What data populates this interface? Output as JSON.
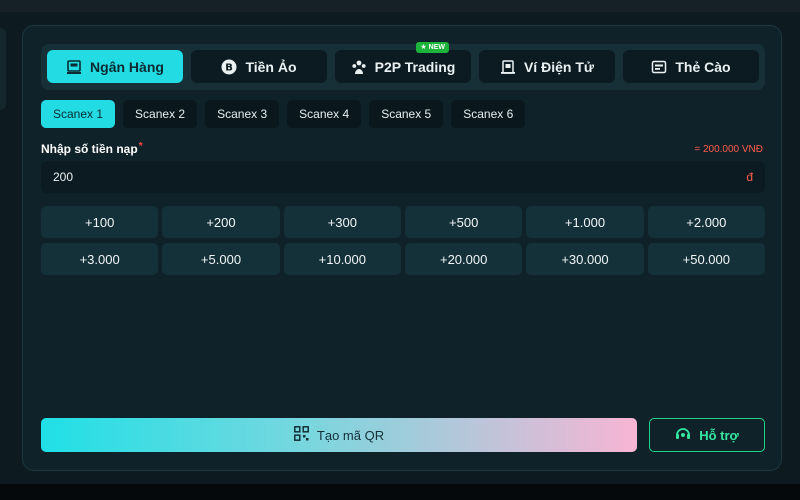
{
  "tabs": [
    {
      "label": "Ngân Hàng",
      "icon": "bank-card-icon",
      "active": true
    },
    {
      "label": "Tiền Ảo",
      "icon": "bitcoin-icon",
      "active": false
    },
    {
      "label": "P2P Trading",
      "icon": "users-icon",
      "active": false,
      "badge": "NEW"
    },
    {
      "label": "Ví Điện Tử",
      "icon": "wallet-icon",
      "active": false
    },
    {
      "label": "Thẻ Cào",
      "icon": "scratch-card-icon",
      "active": false
    }
  ],
  "subtabs": [
    "Scanex 1",
    "Scanex 2",
    "Scanex 3",
    "Scanex 4",
    "Scanex 5",
    "Scanex 6"
  ],
  "amount": {
    "label": "Nhập số tiền nạp",
    "required_mark": "*",
    "conversion": "= 200.000 VNĐ",
    "value": "200",
    "currency": "đ"
  },
  "quick_amounts": [
    "+100",
    "+200",
    "+300",
    "+500",
    "+1.000",
    "+2.000",
    "+3.000",
    "+5.000",
    "+10.000",
    "+20.000",
    "+30.000",
    "+50.000"
  ],
  "actions": {
    "create_qr": "Tạo mã QR",
    "support": "Hỗ trợ"
  },
  "colors": {
    "accent": "#22dbe3",
    "panel": "#0f2229",
    "warning": "#ff5b4a",
    "support": "#34e6a0",
    "new_badge": "#1db43c"
  }
}
